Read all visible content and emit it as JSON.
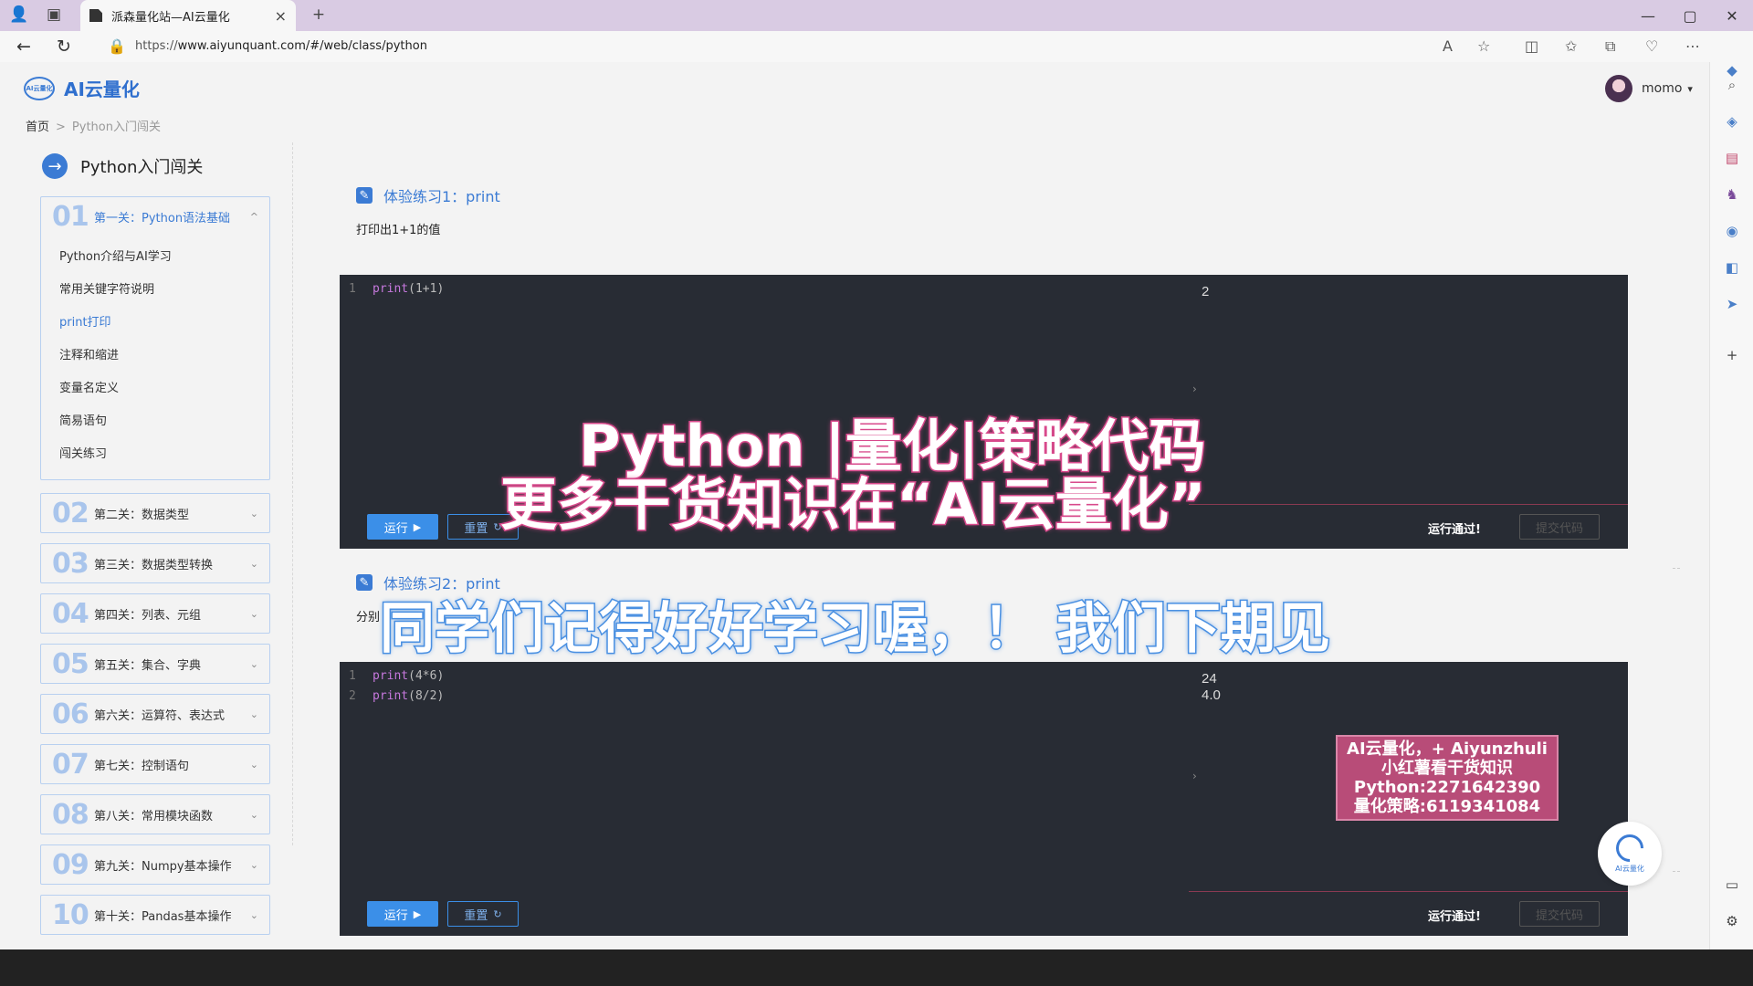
{
  "browser": {
    "tab_title": "派森量化站—AI云量化",
    "url_scheme": "https://",
    "url_rest": "www.aiyunquant.com/#/web/class/python"
  },
  "header": {
    "logo_mark": "AI云量化",
    "logo_text": "AI云量化",
    "username": "momo",
    "user_caret": "▾"
  },
  "breadcrumb": {
    "home": "首页",
    "current": "Python入门闯关"
  },
  "sidebar": {
    "course_title": "Python入门闯关",
    "chapters": [
      {
        "num": "01",
        "name": "第一关：Python语法基础",
        "chev": "^",
        "lessons": [
          "Python介绍与AI学习",
          "常用关键字符说明",
          "print打印",
          "注释和缩进",
          "变量名定义",
          "简易语句",
          "闯关练习"
        ]
      },
      {
        "num": "02",
        "name": "第二关：数据类型",
        "chev": "⌄"
      },
      {
        "num": "03",
        "name": "第三关：数据类型转换",
        "chev": "⌄"
      },
      {
        "num": "04",
        "name": "第四关：列表、元组",
        "chev": "⌄"
      },
      {
        "num": "05",
        "name": "第五关：集合、字典",
        "chev": "⌄"
      },
      {
        "num": "06",
        "name": "第六关：运算符、表达式",
        "chev": "⌄"
      },
      {
        "num": "07",
        "name": "第七关：控制语句",
        "chev": "⌄"
      },
      {
        "num": "08",
        "name": "第八关：常用模块函数",
        "chev": "⌄"
      },
      {
        "num": "09",
        "name": "第九关：Numpy基本操作",
        "chev": "⌄"
      },
      {
        "num": "10",
        "name": "第十关：Pandas基本操作",
        "chev": "⌄"
      }
    ]
  },
  "exercises": [
    {
      "title": "体验练习1：print",
      "desc": "打印出1+1的值",
      "code": [
        {
          "ln": "1",
          "kw": "print",
          "tx": "(1+1)"
        }
      ],
      "output": [
        "2"
      ],
      "run_label": "运行",
      "reset_label": "重置",
      "pass_text": "运行通过!",
      "submit_label": "提交代码"
    },
    {
      "title": "体验练习2：print",
      "desc": "分别",
      "code": [
        {
          "ln": "1",
          "kw": "print",
          "tx": "(4*6)"
        },
        {
          "ln": "2",
          "kw": "print",
          "tx": "(8/2)"
        }
      ],
      "output": [
        "24",
        "4.0"
      ],
      "run_label": "运行",
      "reset_label": "重置",
      "pass_text": "运行通过!",
      "submit_label": "提交代码"
    }
  ],
  "overlays": {
    "line1": "Python |量化|策略代码",
    "line2": "更多干货知识在“AI云量化”",
    "line3": "同学们记得好好学习喔，！ 我们下期见"
  },
  "ad_box": {
    "lines": [
      "AI云量化，+ Aiyunzhuli",
      "小红薯看干货知识",
      "Python:2271642390",
      "量化策略:6119341084"
    ]
  },
  "ai_bot": {
    "label": "AI云量化"
  },
  "colors": {
    "accent": "#3b7bd4",
    "editor_bg": "#282c34",
    "overlay_pink": "#d84a8c",
    "overlay_blue": "#4a90e2"
  }
}
